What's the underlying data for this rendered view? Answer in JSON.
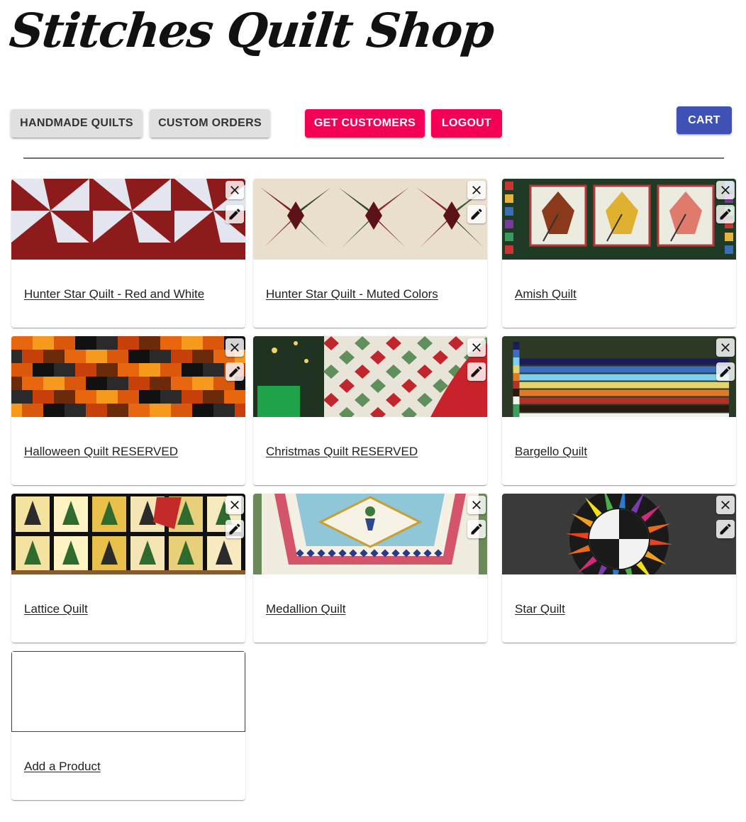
{
  "header": {
    "logo_text": "Stitches Quilt Shop"
  },
  "nav": {
    "handmade_quilts": "HANDMADE QUILTS",
    "custom_orders": "CUSTOM ORDERS",
    "get_customers": "GET CUSTOMERS",
    "logout": "LOGOUT",
    "cart": "CART"
  },
  "colors": {
    "accent_pink": "#f50057",
    "accent_blue": "#3f51b5",
    "grey_button": "#e0e0e0"
  },
  "products": [
    {
      "name": "Hunter Star Quilt - Red and White",
      "image": "red-white-star-quilt"
    },
    {
      "name": "Hunter Star Quilt - Muted Colors",
      "image": "muted-star-quilt"
    },
    {
      "name": "Amish Quilt",
      "image": "amish-leaf-quilt"
    },
    {
      "name": "Halloween Quilt RESERVED",
      "image": "halloween-patchwork-quilt"
    },
    {
      "name": "Christmas Quilt RESERVED",
      "image": "christmas-quilt"
    },
    {
      "name": "Bargello Quilt",
      "image": "bargello-quilt"
    },
    {
      "name": "Lattice Quilt",
      "image": "lattice-quilt"
    },
    {
      "name": "Medallion Quilt",
      "image": "medallion-quilt"
    },
    {
      "name": "Star Quilt",
      "image": "star-quilt"
    }
  ],
  "add_product": {
    "label": "Add a Product"
  },
  "icons": {
    "close": "close-icon",
    "edit": "pencil-icon"
  }
}
